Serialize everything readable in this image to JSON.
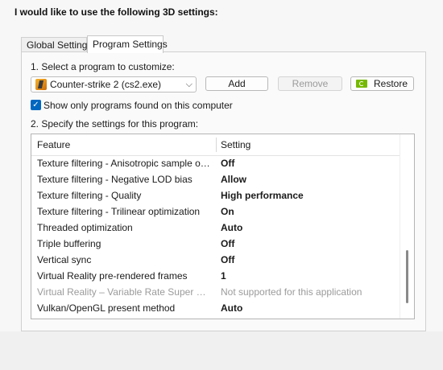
{
  "heading": "I would like to use the following 3D settings:",
  "tabs": [
    {
      "label": "Global Settings",
      "active": false
    },
    {
      "label": "Program Settings",
      "active": true
    }
  ],
  "step1": {
    "label": "1. Select a program to customize:",
    "program_select": {
      "value": "Counter-strike 2 (cs2.exe)",
      "icon": "cs2-icon"
    },
    "add_label": "Add",
    "remove_label": "Remove",
    "restore_label": "Restore",
    "restore_icon": "nvidia-icon"
  },
  "show_only_found": {
    "checked": true,
    "label": "Show only programs found on this computer"
  },
  "step2": {
    "label": "2. Specify the settings for this program:"
  },
  "settings_table": {
    "columns": [
      "Feature",
      "Setting"
    ],
    "rows": [
      {
        "feature": "Texture filtering - Anisotropic sample opti...",
        "setting": "Off",
        "disabled": false
      },
      {
        "feature": "Texture filtering - Negative LOD bias",
        "setting": "Allow",
        "disabled": false
      },
      {
        "feature": "Texture filtering - Quality",
        "setting": "High performance",
        "disabled": false
      },
      {
        "feature": "Texture filtering - Trilinear optimization",
        "setting": "On",
        "disabled": false
      },
      {
        "feature": "Threaded optimization",
        "setting": "Auto",
        "disabled": false
      },
      {
        "feature": "Triple buffering",
        "setting": "Off",
        "disabled": false
      },
      {
        "feature": "Vertical sync",
        "setting": "Off",
        "disabled": false
      },
      {
        "feature": "Virtual Reality pre-rendered frames",
        "setting": "1",
        "disabled": false
      },
      {
        "feature": "Virtual Reality – Variable Rate Super Samp...",
        "setting": "Not supported for this application",
        "disabled": true
      },
      {
        "feature": "Vulkan/OpenGL present method",
        "setting": "Auto",
        "disabled": false
      }
    ]
  },
  "colors": {
    "accent": "#0067c0",
    "nvidia_green": "#76b900"
  }
}
